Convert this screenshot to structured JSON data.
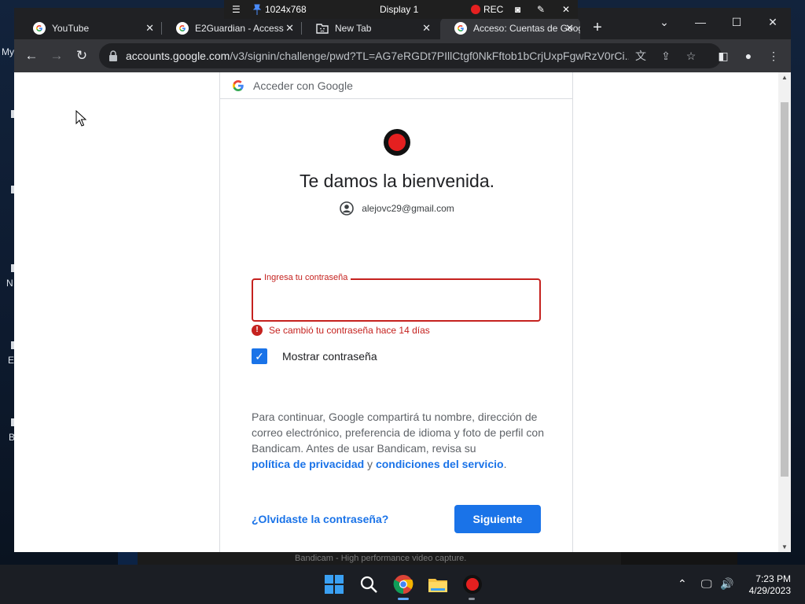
{
  "remote_bar": {
    "resolution": "1024x768",
    "display": "Display 1",
    "rec": "REC"
  },
  "desktop": {
    "fragment_1": "My",
    "fragment_2": "N",
    "fragment_3": "E",
    "fragment_4": "B"
  },
  "tabs": [
    {
      "title": "YouTube",
      "icon": "google-icon"
    },
    {
      "title": "E2Guardian - Access",
      "icon": "google-icon"
    },
    {
      "title": "New Tab",
      "icon": "sad-tab-icon"
    },
    {
      "title": "Acceso: Cuentas de Google",
      "icon": "google-icon"
    }
  ],
  "toolbar": {
    "url_host": "accounts.google.com",
    "url_path": "/v3/signin/challenge/pwd?TL=AG7eRGDt7PIllCtgf0NkFftob1bCrjUxpFgwRzV0rCi..."
  },
  "signin": {
    "header_title": "Acceder con Google",
    "welcome": "Te damos la bienvenida.",
    "account_email": "alejovc29@gmail.com",
    "password_label": "Ingresa tu contraseña",
    "password_value": "",
    "error_text": "Se cambió tu contraseña hace 14 días",
    "show_password_label": "Mostrar contraseña",
    "show_password_checked": true,
    "consent_text": "Para continuar, Google compartirá tu nombre, dirección de correo electrónico, preferencia de idioma y foto de perfil con Bandicam. Antes de usar Bandicam, revisa su",
    "privacy_link": "política de privacidad",
    "consent_join": "y",
    "terms_link": "condiciones del servicio",
    "consent_end": ".",
    "forgot_link": "¿Olvidaste la contraseña?",
    "next_button": "Siguiente"
  },
  "bandicam_strip": "Bandicam - High performance video capture.",
  "taskbar": {
    "time": "7:23 PM",
    "date": "4/29/2023"
  },
  "colors": {
    "accent": "#1a73e8",
    "error": "#c5221f",
    "record_red": "#e52020"
  }
}
